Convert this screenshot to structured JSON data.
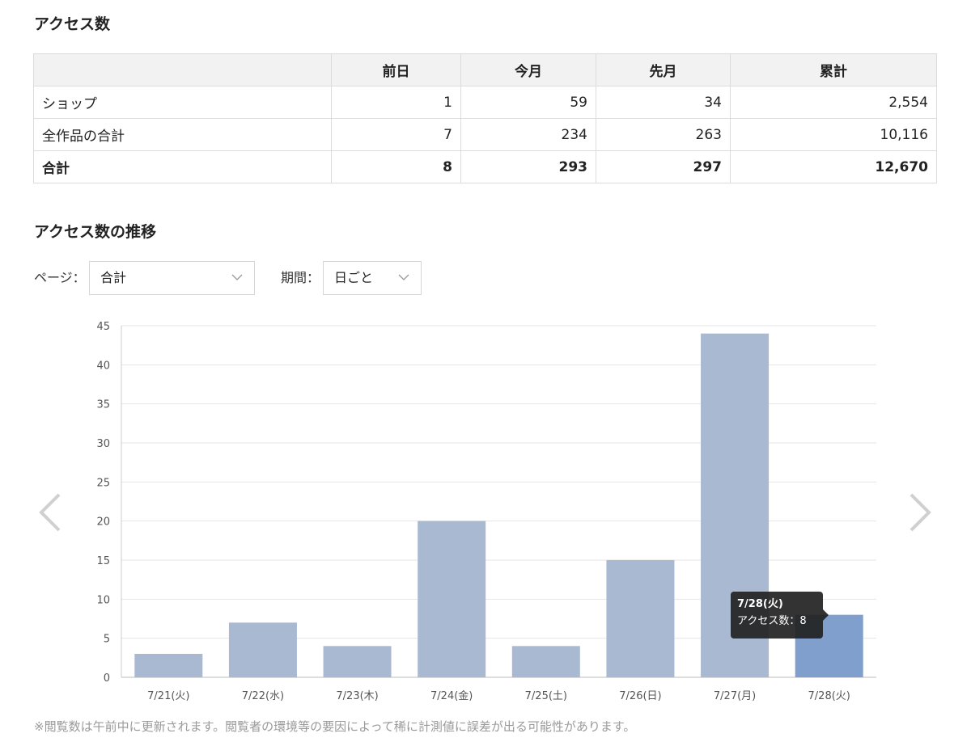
{
  "access_section": {
    "title": "アクセス数",
    "table": {
      "headers": [
        "",
        "前日",
        "今月",
        "先月",
        "累計"
      ],
      "rows": [
        {
          "label": "ショップ",
          "values": [
            "1",
            "59",
            "34",
            "2,554"
          ]
        },
        {
          "label": "全作品の合計",
          "values": [
            "7",
            "234",
            "263",
            "10,116"
          ]
        },
        {
          "label": "合計",
          "values": [
            "8",
            "293",
            "297",
            "12,670"
          ],
          "bold": true
        }
      ]
    }
  },
  "trend_section": {
    "title": "アクセス数の推移",
    "page_filter": {
      "label": "ページ：",
      "value": "合計"
    },
    "period_filter": {
      "label": "期間：",
      "value": "日ごと"
    }
  },
  "chart_data": {
    "type": "bar",
    "categories": [
      "7/21(火)",
      "7/22(水)",
      "7/23(木)",
      "7/24(金)",
      "7/25(土)",
      "7/26(日)",
      "7/27(月)",
      "7/28(火)"
    ],
    "values": [
      3,
      7,
      4,
      20,
      4,
      15,
      44,
      8
    ],
    "ylim": [
      0,
      45
    ],
    "yticks": [
      0,
      5,
      10,
      15,
      20,
      25,
      30,
      35,
      40,
      45
    ],
    "grid": true,
    "bar_color": "#aab9d2",
    "highlight_color": "#819fcd",
    "highlight_index": 7,
    "tooltip": {
      "title": "7/28(火)",
      "label": "アクセス数：",
      "value": "8"
    }
  },
  "footnote": "※閲覧数は午前中に更新されます。閲覧者の環境等の要因によって稀に計測値に誤差が出る可能性があります。"
}
